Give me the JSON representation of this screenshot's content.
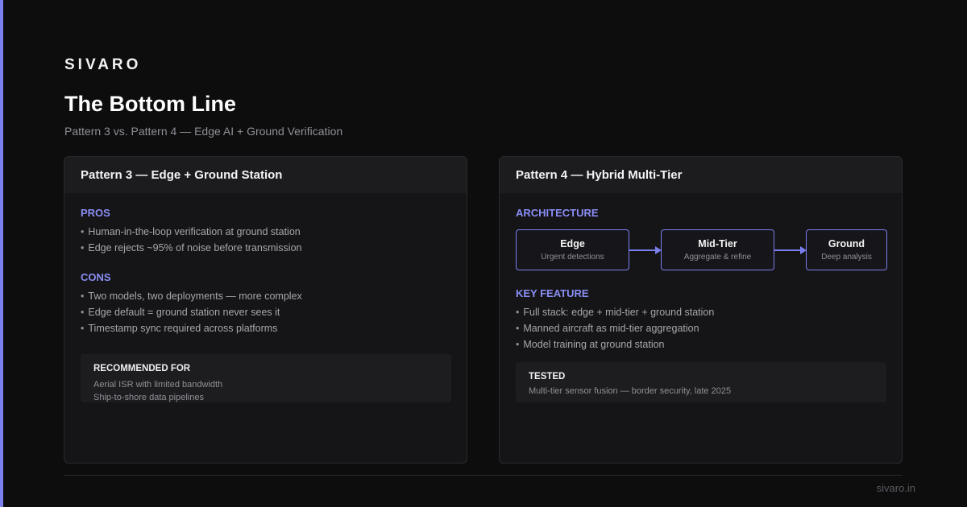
{
  "brand": "SIVARO",
  "title": "The Bottom Line",
  "subtitle": "Pattern 3 vs. Pattern 4 — Edge AI + Ground Verification",
  "colors": {
    "accent": "#7b7ff0",
    "background": "#0d0d0e",
    "card": "#151517"
  },
  "left_card": {
    "heading": "Pattern 3 — Edge + Ground Station",
    "pros_label": "PROS",
    "pros": [
      "Human-in-the-loop verification at ground station",
      "Edge rejects ~95% of noise before transmission"
    ],
    "cons_label": "CONS",
    "cons": [
      "Two models, two deployments — more complex",
      "Edge default = ground station never sees it",
      "Timestamp sync required across platforms"
    ],
    "recommended": {
      "label": "RECOMMENDED FOR",
      "lines": [
        "Aerial ISR with limited bandwidth",
        "Ship-to-shore data pipelines"
      ]
    }
  },
  "right_card": {
    "heading": "Pattern 4 — Hybrid Multi-Tier",
    "architecture_label": "ARCHITECTURE",
    "nodes": [
      {
        "name": "Edge",
        "desc": "Urgent detections"
      },
      {
        "name": "Mid-Tier",
        "desc": "Aggregate & refine"
      },
      {
        "name": "Ground",
        "desc": "Deep analysis"
      }
    ],
    "key_feature_label": "KEY FEATURE",
    "features": [
      "Full stack: edge + mid-tier + ground station",
      "Manned aircraft as mid-tier aggregation",
      "Model training at ground station"
    ],
    "tested": {
      "label": "TESTED",
      "line": "Multi-tier sensor fusion — border security, late 2025"
    }
  },
  "footer_url": "sivaro.in"
}
